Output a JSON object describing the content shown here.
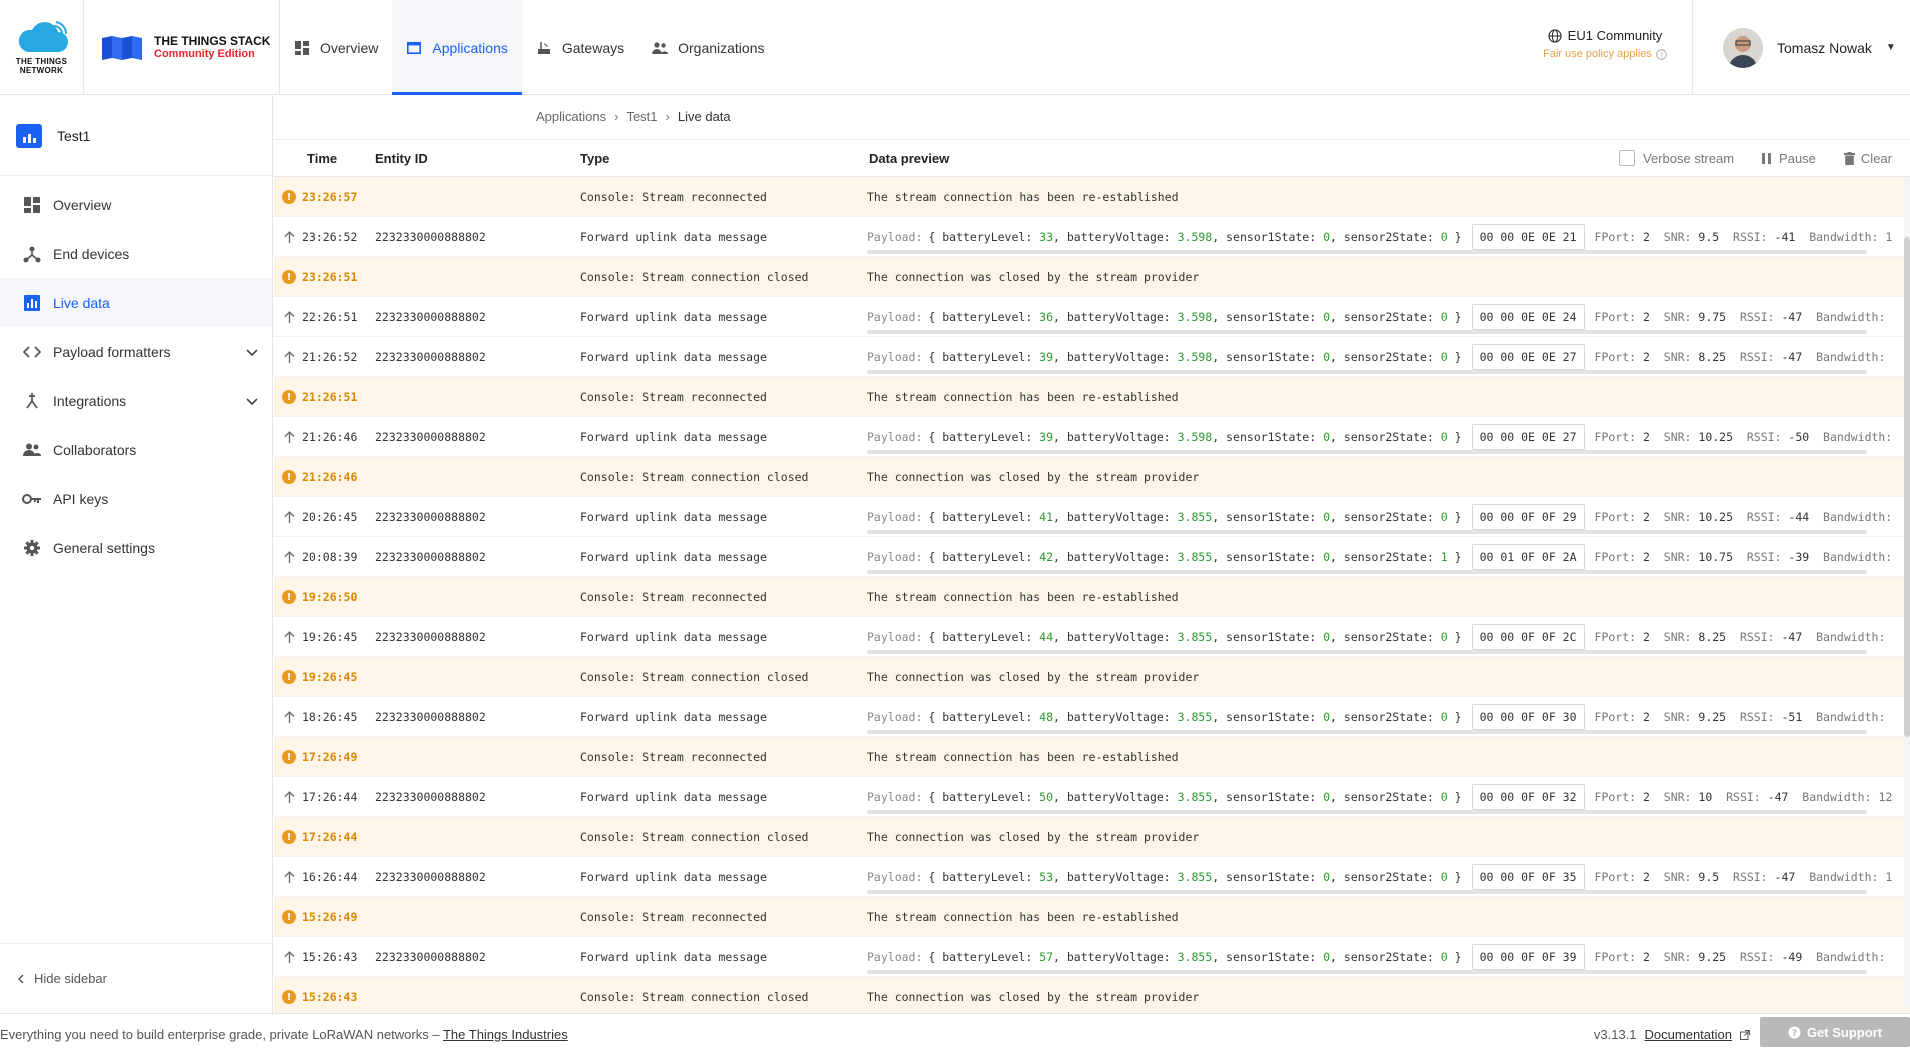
{
  "header": {
    "ttn_logo_text": "THE THINGS NETWORK",
    "tts_title": "THE THINGS STACK",
    "tts_subtitle": "Community Edition",
    "nav": [
      {
        "label": "Overview",
        "active": false
      },
      {
        "label": "Applications",
        "active": true
      },
      {
        "label": "Gateways",
        "active": false
      },
      {
        "label": "Organizations",
        "active": false
      }
    ],
    "community": "EU1 Community",
    "fair_use": "Fair use policy applies",
    "user_name": "Tomasz Nowak"
  },
  "sidebar": {
    "app_name": "Test1",
    "items": [
      {
        "label": "Overview",
        "icon": "grid-icon"
      },
      {
        "label": "End devices",
        "icon": "devices-icon"
      },
      {
        "label": "Live data",
        "icon": "chart-icon",
        "active": true
      },
      {
        "label": "Payload formatters",
        "icon": "code-icon",
        "expandable": true
      },
      {
        "label": "Integrations",
        "icon": "integrations-icon",
        "expandable": true
      },
      {
        "label": "Collaborators",
        "icon": "people-icon"
      },
      {
        "label": "API keys",
        "icon": "key-icon"
      },
      {
        "label": "General settings",
        "icon": "gear-icon"
      }
    ],
    "hide_label": "Hide sidebar"
  },
  "breadcrumb": [
    "Applications",
    "Test1",
    "Live data"
  ],
  "table": {
    "headers": {
      "time": "Time",
      "entity": "Entity ID",
      "type": "Type",
      "preview": "Data preview"
    },
    "controls": {
      "verbose": "Verbose stream",
      "pause": "Pause",
      "clear": "Clear"
    },
    "payload_label": "Payload:",
    "rows": [
      {
        "kind": "warn",
        "time": "23:26:57",
        "entity": "",
        "type": "Console: Stream reconnected",
        "text": "The stream connection has been re-established"
      },
      {
        "kind": "up",
        "time": "23:26:52",
        "entity": "2232330000888802",
        "type": "Forward uplink data message",
        "bl": "33",
        "bv": "3.598",
        "s1": "0",
        "s2": "0",
        "hex": "00 00 0E 0E 21",
        "fport": "2",
        "snr": "9.5",
        "rssi": "-41",
        "bw": "Bandwidth: 1"
      },
      {
        "kind": "warn",
        "time": "23:26:51",
        "entity": "",
        "type": "Console: Stream connection closed",
        "text": "The connection was closed by the stream provider"
      },
      {
        "kind": "up",
        "time": "22:26:51",
        "entity": "2232330000888802",
        "type": "Forward uplink data message",
        "bl": "36",
        "bv": "3.598",
        "s1": "0",
        "s2": "0",
        "hex": "00 00 0E 0E 24",
        "fport": "2",
        "snr": "9.75",
        "rssi": "-47",
        "bw": "Bandwidth:"
      },
      {
        "kind": "up",
        "time": "21:26:52",
        "entity": "2232330000888802",
        "type": "Forward uplink data message",
        "bl": "39",
        "bv": "3.598",
        "s1": "0",
        "s2": "0",
        "hex": "00 00 0E 0E 27",
        "fport": "2",
        "snr": "8.25",
        "rssi": "-47",
        "bw": "Bandwidth:"
      },
      {
        "kind": "warn",
        "time": "21:26:51",
        "entity": "",
        "type": "Console: Stream reconnected",
        "text": "The stream connection has been re-established"
      },
      {
        "kind": "up",
        "time": "21:26:46",
        "entity": "2232330000888802",
        "type": "Forward uplink data message",
        "bl": "39",
        "bv": "3.598",
        "s1": "0",
        "s2": "0",
        "hex": "00 00 0E 0E 27",
        "fport": "2",
        "snr": "10.25",
        "rssi": "-50",
        "bw": "Bandwidth:"
      },
      {
        "kind": "warn",
        "time": "21:26:46",
        "entity": "",
        "type": "Console: Stream connection closed",
        "text": "The connection was closed by the stream provider"
      },
      {
        "kind": "up",
        "time": "20:26:45",
        "entity": "2232330000888802",
        "type": "Forward uplink data message",
        "bl": "41",
        "bv": "3.855",
        "s1": "0",
        "s2": "0",
        "hex": "00 00 0F 0F 29",
        "fport": "2",
        "snr": "10.25",
        "rssi": "-44",
        "bw": "Bandwidth:"
      },
      {
        "kind": "up",
        "time": "20:08:39",
        "entity": "2232330000888802",
        "type": "Forward uplink data message",
        "bl": "42",
        "bv": "3.855",
        "s1": "0",
        "s2": "1",
        "hex": "00 01 0F 0F 2A",
        "fport": "2",
        "snr": "10.75",
        "rssi": "-39",
        "bw": "Bandwidth:"
      },
      {
        "kind": "warn",
        "time": "19:26:50",
        "entity": "",
        "type": "Console: Stream reconnected",
        "text": "The stream connection has been re-established"
      },
      {
        "kind": "up",
        "time": "19:26:45",
        "entity": "2232330000888802",
        "type": "Forward uplink data message",
        "bl": "44",
        "bv": "3.855",
        "s1": "0",
        "s2": "0",
        "hex": "00 00 0F 0F 2C",
        "fport": "2",
        "snr": "8.25",
        "rssi": "-47",
        "bw": "Bandwidth:"
      },
      {
        "kind": "warn",
        "time": "19:26:45",
        "entity": "",
        "type": "Console: Stream connection closed",
        "text": "The connection was closed by the stream provider"
      },
      {
        "kind": "up",
        "time": "18:26:45",
        "entity": "2232330000888802",
        "type": "Forward uplink data message",
        "bl": "48",
        "bv": "3.855",
        "s1": "0",
        "s2": "0",
        "hex": "00 00 0F 0F 30",
        "fport": "2",
        "snr": "9.25",
        "rssi": "-51",
        "bw": "Bandwidth:"
      },
      {
        "kind": "warn",
        "time": "17:26:49",
        "entity": "",
        "type": "Console: Stream reconnected",
        "text": "The stream connection has been re-established"
      },
      {
        "kind": "up",
        "time": "17:26:44",
        "entity": "2232330000888802",
        "type": "Forward uplink data message",
        "bl": "50",
        "bv": "3.855",
        "s1": "0",
        "s2": "0",
        "hex": "00 00 0F 0F 32",
        "fport": "2",
        "snr": "10",
        "rssi": "-47",
        "bw": "Bandwidth: 12"
      },
      {
        "kind": "warn",
        "time": "17:26:44",
        "entity": "",
        "type": "Console: Stream connection closed",
        "text": "The connection was closed by the stream provider"
      },
      {
        "kind": "up",
        "time": "16:26:44",
        "entity": "2232330000888802",
        "type": "Forward uplink data message",
        "bl": "53",
        "bv": "3.855",
        "s1": "0",
        "s2": "0",
        "hex": "00 00 0F 0F 35",
        "fport": "2",
        "snr": "9.5",
        "rssi": "-47",
        "bw": "Bandwidth: 1"
      },
      {
        "kind": "warn",
        "time": "15:26:49",
        "entity": "",
        "type": "Console: Stream reconnected",
        "text": "The stream connection has been re-established"
      },
      {
        "kind": "up",
        "time": "15:26:43",
        "entity": "2232330000888802",
        "type": "Forward uplink data message",
        "bl": "57",
        "bv": "3.855",
        "s1": "0",
        "s2": "0",
        "hex": "00 00 0F 0F 39",
        "fport": "2",
        "snr": "9.25",
        "rssi": "-49",
        "bw": "Bandwidth:"
      },
      {
        "kind": "warn",
        "time": "15:26:43",
        "entity": "",
        "type": "Console: Stream connection closed",
        "text": "The connection was closed by the stream provider"
      }
    ]
  },
  "footer": {
    "tagline": "Everything you need to build enterprise grade, private LoRaWAN networks – ",
    "company_link": "The Things Industries",
    "version": "v3.13.1",
    "docs": "Documentation",
    "support": "Get Support"
  },
  "colors": {
    "accent": "#1a62f5",
    "warning": "#d98a00",
    "payload_number": "#2c9b2c",
    "brand_red": "#e8232e"
  }
}
